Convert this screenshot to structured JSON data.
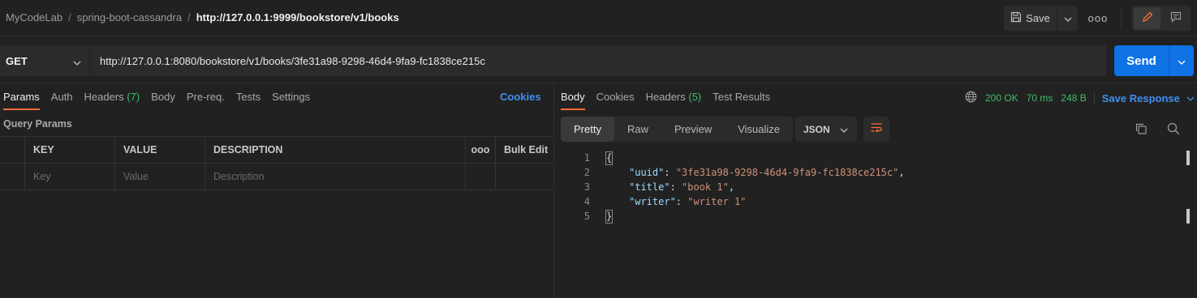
{
  "breadcrumb": {
    "workspace": "MyCodeLab",
    "collection": "spring-boot-cassandra",
    "request": "http://127.0.0.1:9999/bookstore/v1/books",
    "separator": "/"
  },
  "toolbar": {
    "save_label": "Save",
    "more_label": "ooo"
  },
  "request": {
    "method": "GET",
    "url": "http://127.0.0.1:8080/bookstore/v1/books/3fe31a98-9298-46d4-9fa9-fc1838ce215c",
    "send_label": "Send",
    "tabs": [
      {
        "label": "Params",
        "count": ""
      },
      {
        "label": "Auth",
        "count": ""
      },
      {
        "label": "Headers",
        "count": "(7)"
      },
      {
        "label": "Body",
        "count": ""
      },
      {
        "label": "Pre-req.",
        "count": ""
      },
      {
        "label": "Tests",
        "count": ""
      },
      {
        "label": "Settings",
        "count": ""
      }
    ],
    "cookies_label": "Cookies",
    "query_params_label": "Query Params",
    "table": {
      "headers": {
        "key": "KEY",
        "value": "VALUE",
        "description": "DESCRIPTION",
        "more": "ooo",
        "bulk_edit": "Bulk Edit"
      },
      "placeholders": {
        "key": "Key",
        "value": "Value",
        "description": "Description"
      }
    }
  },
  "response": {
    "tabs": [
      {
        "label": "Body",
        "count": ""
      },
      {
        "label": "Cookies",
        "count": ""
      },
      {
        "label": "Headers",
        "count": "(5)"
      },
      {
        "label": "Test Results",
        "count": ""
      }
    ],
    "status": "200 OK",
    "time": "70 ms",
    "size": "248 B",
    "save_response_label": "Save Response",
    "view_modes": [
      "Pretty",
      "Raw",
      "Preview",
      "Visualize"
    ],
    "format": "JSON",
    "body_lines": [
      {
        "n": "1",
        "key": "",
        "value": "",
        "bracket": "{"
      },
      {
        "n": "2",
        "key": "\"uuid\"",
        "value": "\"3fe31a98-9298-46d4-9fa9-fc1838ce215c\"",
        "comma": ","
      },
      {
        "n": "3",
        "key": "\"title\"",
        "value": "\"book 1\"",
        "comma": ","
      },
      {
        "n": "4",
        "key": "\"writer\"",
        "value": "\"writer 1\"",
        "comma": ""
      },
      {
        "n": "5",
        "key": "",
        "value": "",
        "bracket": "}"
      }
    ]
  },
  "colors": {
    "accent_orange": "#ff6c37",
    "link_blue": "#3f8ff0",
    "send_blue": "#0f72e5",
    "status_green": "#3ebd6a"
  },
  "icons": [
    "save-icon",
    "chevron-down-icon",
    "pencil-icon",
    "comment-icon",
    "globe-icon",
    "wrap-lines-icon",
    "copy-icon",
    "search-icon"
  ]
}
